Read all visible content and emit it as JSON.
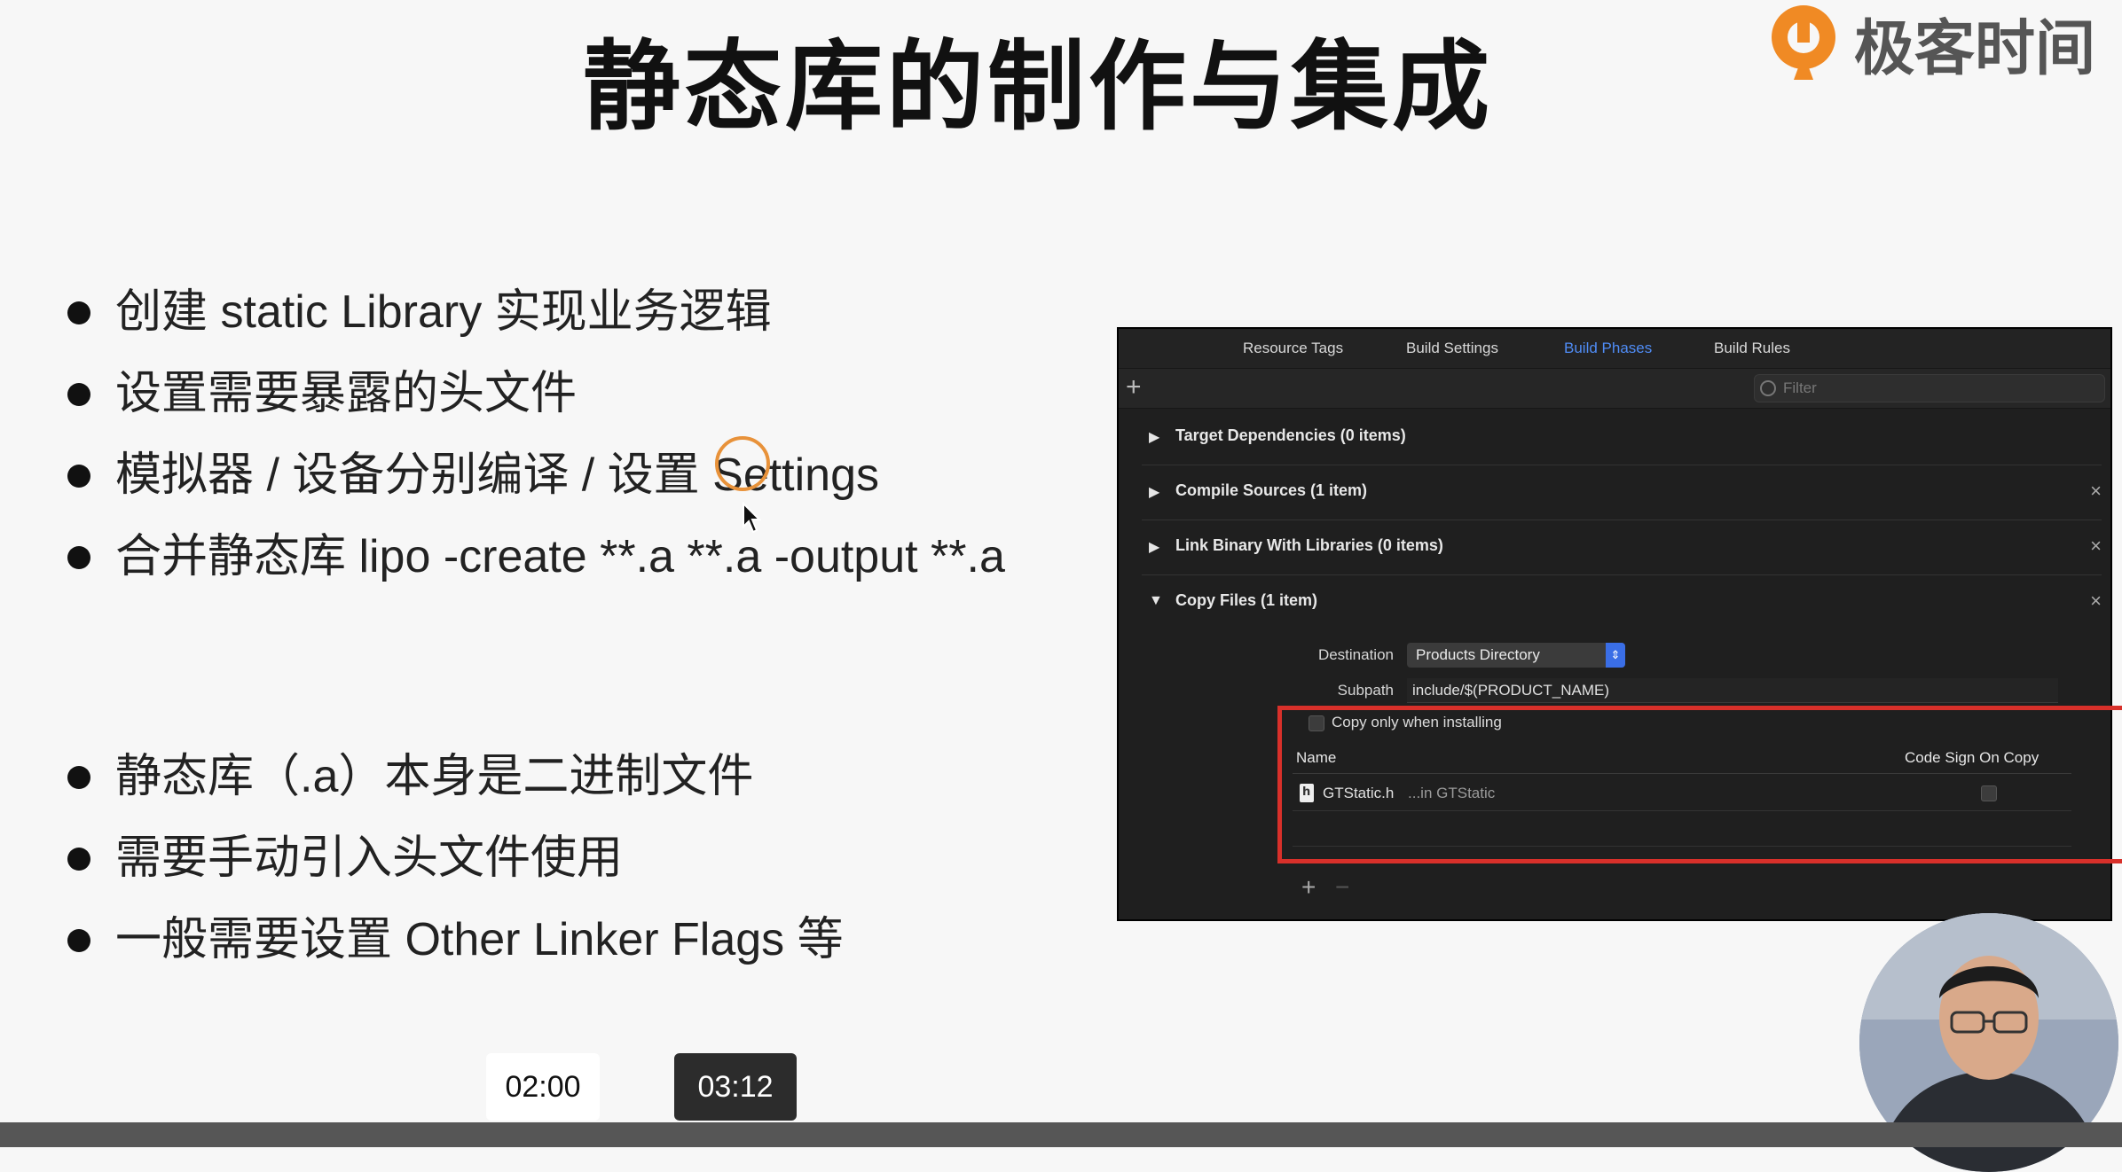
{
  "slide": {
    "title": "静态库的制作与集成",
    "brand": "极客时间",
    "bullets_group1": [
      "创建 static Library 实现业务逻辑",
      "设置需要暴露的头文件",
      "模拟器 / 设备分别编译 / 设置 Settings",
      "合并静态库 lipo -create **.a **.a -output **.a"
    ],
    "bullets_group2": [
      "静态库（.a）本身是二进制文件",
      "需要手动引入头文件使用",
      "一般需要设置 Other Linker Flags 等"
    ]
  },
  "xcode": {
    "tabs": [
      "Resource Tags",
      "Build Settings",
      "Build Phases",
      "Build Rules"
    ],
    "active_tab": "Build Phases",
    "filter_placeholder": "Filter",
    "phases": [
      {
        "name": "Target Dependencies (0 items)",
        "expanded": false
      },
      {
        "name": "Compile Sources (1 item)",
        "expanded": false
      },
      {
        "name": "Link Binary With Libraries (0 items)",
        "expanded": false
      },
      {
        "name": "Copy Files (1 item)",
        "expanded": true
      }
    ],
    "copy_files": {
      "destination_label": "Destination",
      "destination_value": "Products Directory",
      "subpath_label": "Subpath",
      "subpath_value": "include/$(PRODUCT_NAME)",
      "copy_only_label": "Copy only when installing",
      "col_name": "Name",
      "col_codesign": "Code Sign On Copy",
      "file_name": "GTStatic.h",
      "file_location": "...in GTStatic",
      "file_icon": "h"
    }
  },
  "player": {
    "time_a": "02:00",
    "time_b": "03:12"
  },
  "colors": {
    "accent_blue": "#4f8cf5",
    "highlight_red": "#d8302a",
    "cursor_ring": "#e8923a",
    "brand_orange": "#f08a24"
  }
}
